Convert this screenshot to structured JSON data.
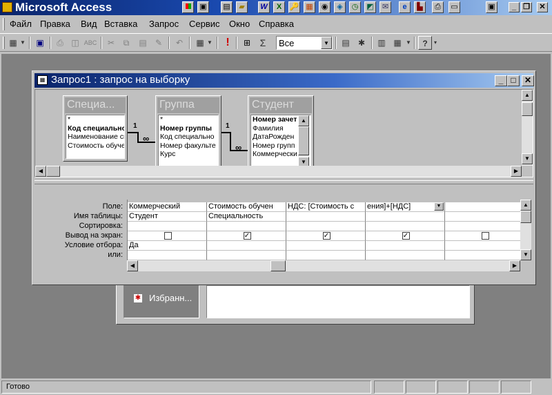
{
  "app": {
    "title": "Microsoft Access"
  },
  "menu": [
    "Файл",
    "Правка",
    "Вид",
    "Вставка",
    "Запрос",
    "Сервис",
    "Окно",
    "Справка"
  ],
  "toolbar": {
    "filter_combo_value": "Все"
  },
  "query_window": {
    "title": "Запрос1 : запрос на выборку",
    "tables": [
      {
        "title": "Специа...",
        "fields": [
          "*",
          "Код специально",
          "Наименование сп",
          "Стоимость обуче"
        ]
      },
      {
        "title": "Группа",
        "fields": [
          "*",
          "Номер группы",
          "Код специально",
          "Номер факульте",
          "Курс"
        ]
      },
      {
        "title": "Студент",
        "fields": [
          "Номер зачетн",
          "Фамилия",
          "ДатаРожден",
          "Номер групп",
          "Коммерчески"
        ]
      }
    ],
    "relations": [
      {
        "one": "1",
        "many": "∞"
      },
      {
        "one": "1",
        "many": "∞"
      }
    ],
    "grid": {
      "row_labels": [
        "Поле:",
        "Имя таблицы:",
        "Сортировка:",
        "Вывод на экран:",
        "Условие отбора:",
        "или:"
      ],
      "columns": [
        {
          "field": "Коммерческий",
          "table": "Студент",
          "sort": "",
          "show": false,
          "criteria": "Да"
        },
        {
          "field": "Стоимость обучен",
          "table": "Специальность",
          "sort": "",
          "show": true,
          "criteria": ""
        },
        {
          "field": "НДС: [Стоимость с",
          "table": "",
          "sort": "",
          "show": true,
          "criteria": ""
        },
        {
          "field": "ения]+[НДС]",
          "table": "",
          "sort": "",
          "show": true,
          "criteria": ""
        },
        {
          "field": "",
          "table": "",
          "sort": "",
          "show": false,
          "criteria": ""
        }
      ]
    }
  },
  "db_window": {
    "favorites_label": "Избранн..."
  },
  "status": {
    "text": "Готово"
  }
}
